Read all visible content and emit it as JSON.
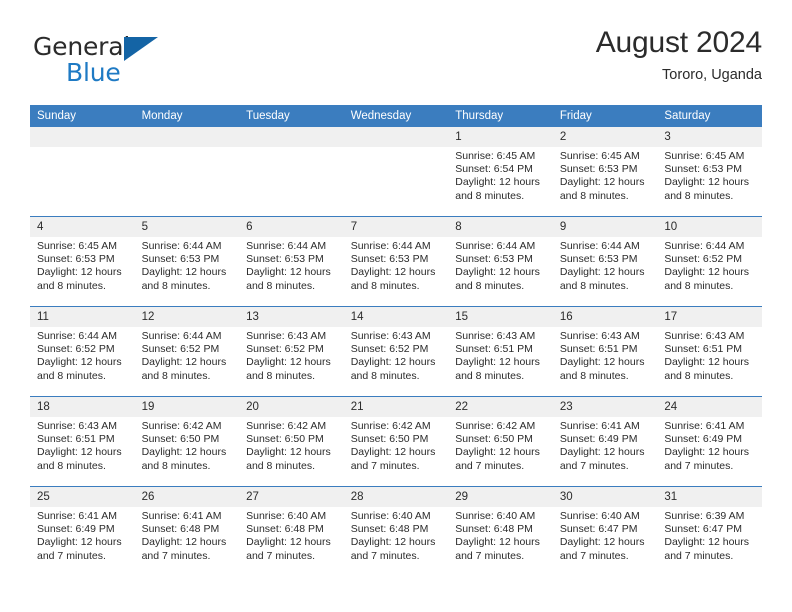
{
  "brand": {
    "name_part1": "General",
    "name_part2": "Blue",
    "flag_icon": "brand-flag-icon"
  },
  "header": {
    "title": "August 2024",
    "subtitle": "Tororo, Uganda"
  },
  "calendar": {
    "day_headers": [
      "Sunday",
      "Monday",
      "Tuesday",
      "Wednesday",
      "Thursday",
      "Friday",
      "Saturday"
    ],
    "header_bg": "#3b7dbf",
    "date_band_bg": "#f0f0f0",
    "weeks": [
      [
        {
          "day": "",
          "sunrise": "",
          "sunset": "",
          "daylight": "",
          "daylight2": ""
        },
        {
          "day": "",
          "sunrise": "",
          "sunset": "",
          "daylight": "",
          "daylight2": ""
        },
        {
          "day": "",
          "sunrise": "",
          "sunset": "",
          "daylight": "",
          "daylight2": ""
        },
        {
          "day": "",
          "sunrise": "",
          "sunset": "",
          "daylight": "",
          "daylight2": ""
        },
        {
          "day": "1",
          "sunrise": "Sunrise: 6:45 AM",
          "sunset": "Sunset: 6:54 PM",
          "daylight": "Daylight: 12 hours",
          "daylight2": "and 8 minutes."
        },
        {
          "day": "2",
          "sunrise": "Sunrise: 6:45 AM",
          "sunset": "Sunset: 6:53 PM",
          "daylight": "Daylight: 12 hours",
          "daylight2": "and 8 minutes."
        },
        {
          "day": "3",
          "sunrise": "Sunrise: 6:45 AM",
          "sunset": "Sunset: 6:53 PM",
          "daylight": "Daylight: 12 hours",
          "daylight2": "and 8 minutes."
        }
      ],
      [
        {
          "day": "4",
          "sunrise": "Sunrise: 6:45 AM",
          "sunset": "Sunset: 6:53 PM",
          "daylight": "Daylight: 12 hours",
          "daylight2": "and 8 minutes."
        },
        {
          "day": "5",
          "sunrise": "Sunrise: 6:44 AM",
          "sunset": "Sunset: 6:53 PM",
          "daylight": "Daylight: 12 hours",
          "daylight2": "and 8 minutes."
        },
        {
          "day": "6",
          "sunrise": "Sunrise: 6:44 AM",
          "sunset": "Sunset: 6:53 PM",
          "daylight": "Daylight: 12 hours",
          "daylight2": "and 8 minutes."
        },
        {
          "day": "7",
          "sunrise": "Sunrise: 6:44 AM",
          "sunset": "Sunset: 6:53 PM",
          "daylight": "Daylight: 12 hours",
          "daylight2": "and 8 minutes."
        },
        {
          "day": "8",
          "sunrise": "Sunrise: 6:44 AM",
          "sunset": "Sunset: 6:53 PM",
          "daylight": "Daylight: 12 hours",
          "daylight2": "and 8 minutes."
        },
        {
          "day": "9",
          "sunrise": "Sunrise: 6:44 AM",
          "sunset": "Sunset: 6:53 PM",
          "daylight": "Daylight: 12 hours",
          "daylight2": "and 8 minutes."
        },
        {
          "day": "10",
          "sunrise": "Sunrise: 6:44 AM",
          "sunset": "Sunset: 6:52 PM",
          "daylight": "Daylight: 12 hours",
          "daylight2": "and 8 minutes."
        }
      ],
      [
        {
          "day": "11",
          "sunrise": "Sunrise: 6:44 AM",
          "sunset": "Sunset: 6:52 PM",
          "daylight": "Daylight: 12 hours",
          "daylight2": "and 8 minutes."
        },
        {
          "day": "12",
          "sunrise": "Sunrise: 6:44 AM",
          "sunset": "Sunset: 6:52 PM",
          "daylight": "Daylight: 12 hours",
          "daylight2": "and 8 minutes."
        },
        {
          "day": "13",
          "sunrise": "Sunrise: 6:43 AM",
          "sunset": "Sunset: 6:52 PM",
          "daylight": "Daylight: 12 hours",
          "daylight2": "and 8 minutes."
        },
        {
          "day": "14",
          "sunrise": "Sunrise: 6:43 AM",
          "sunset": "Sunset: 6:52 PM",
          "daylight": "Daylight: 12 hours",
          "daylight2": "and 8 minutes."
        },
        {
          "day": "15",
          "sunrise": "Sunrise: 6:43 AM",
          "sunset": "Sunset: 6:51 PM",
          "daylight": "Daylight: 12 hours",
          "daylight2": "and 8 minutes."
        },
        {
          "day": "16",
          "sunrise": "Sunrise: 6:43 AM",
          "sunset": "Sunset: 6:51 PM",
          "daylight": "Daylight: 12 hours",
          "daylight2": "and 8 minutes."
        },
        {
          "day": "17",
          "sunrise": "Sunrise: 6:43 AM",
          "sunset": "Sunset: 6:51 PM",
          "daylight": "Daylight: 12 hours",
          "daylight2": "and 8 minutes."
        }
      ],
      [
        {
          "day": "18",
          "sunrise": "Sunrise: 6:43 AM",
          "sunset": "Sunset: 6:51 PM",
          "daylight": "Daylight: 12 hours",
          "daylight2": "and 8 minutes."
        },
        {
          "day": "19",
          "sunrise": "Sunrise: 6:42 AM",
          "sunset": "Sunset: 6:50 PM",
          "daylight": "Daylight: 12 hours",
          "daylight2": "and 8 minutes."
        },
        {
          "day": "20",
          "sunrise": "Sunrise: 6:42 AM",
          "sunset": "Sunset: 6:50 PM",
          "daylight": "Daylight: 12 hours",
          "daylight2": "and 8 minutes."
        },
        {
          "day": "21",
          "sunrise": "Sunrise: 6:42 AM",
          "sunset": "Sunset: 6:50 PM",
          "daylight": "Daylight: 12 hours",
          "daylight2": "and 7 minutes."
        },
        {
          "day": "22",
          "sunrise": "Sunrise: 6:42 AM",
          "sunset": "Sunset: 6:50 PM",
          "daylight": "Daylight: 12 hours",
          "daylight2": "and 7 minutes."
        },
        {
          "day": "23",
          "sunrise": "Sunrise: 6:41 AM",
          "sunset": "Sunset: 6:49 PM",
          "daylight": "Daylight: 12 hours",
          "daylight2": "and 7 minutes."
        },
        {
          "day": "24",
          "sunrise": "Sunrise: 6:41 AM",
          "sunset": "Sunset: 6:49 PM",
          "daylight": "Daylight: 12 hours",
          "daylight2": "and 7 minutes."
        }
      ],
      [
        {
          "day": "25",
          "sunrise": "Sunrise: 6:41 AM",
          "sunset": "Sunset: 6:49 PM",
          "daylight": "Daylight: 12 hours",
          "daylight2": "and 7 minutes."
        },
        {
          "day": "26",
          "sunrise": "Sunrise: 6:41 AM",
          "sunset": "Sunset: 6:48 PM",
          "daylight": "Daylight: 12 hours",
          "daylight2": "and 7 minutes."
        },
        {
          "day": "27",
          "sunrise": "Sunrise: 6:40 AM",
          "sunset": "Sunset: 6:48 PM",
          "daylight": "Daylight: 12 hours",
          "daylight2": "and 7 minutes."
        },
        {
          "day": "28",
          "sunrise": "Sunrise: 6:40 AM",
          "sunset": "Sunset: 6:48 PM",
          "daylight": "Daylight: 12 hours",
          "daylight2": "and 7 minutes."
        },
        {
          "day": "29",
          "sunrise": "Sunrise: 6:40 AM",
          "sunset": "Sunset: 6:48 PM",
          "daylight": "Daylight: 12 hours",
          "daylight2": "and 7 minutes."
        },
        {
          "day": "30",
          "sunrise": "Sunrise: 6:40 AM",
          "sunset": "Sunset: 6:47 PM",
          "daylight": "Daylight: 12 hours",
          "daylight2": "and 7 minutes."
        },
        {
          "day": "31",
          "sunrise": "Sunrise: 6:39 AM",
          "sunset": "Sunset: 6:47 PM",
          "daylight": "Daylight: 12 hours",
          "daylight2": "and 7 minutes."
        }
      ]
    ]
  }
}
